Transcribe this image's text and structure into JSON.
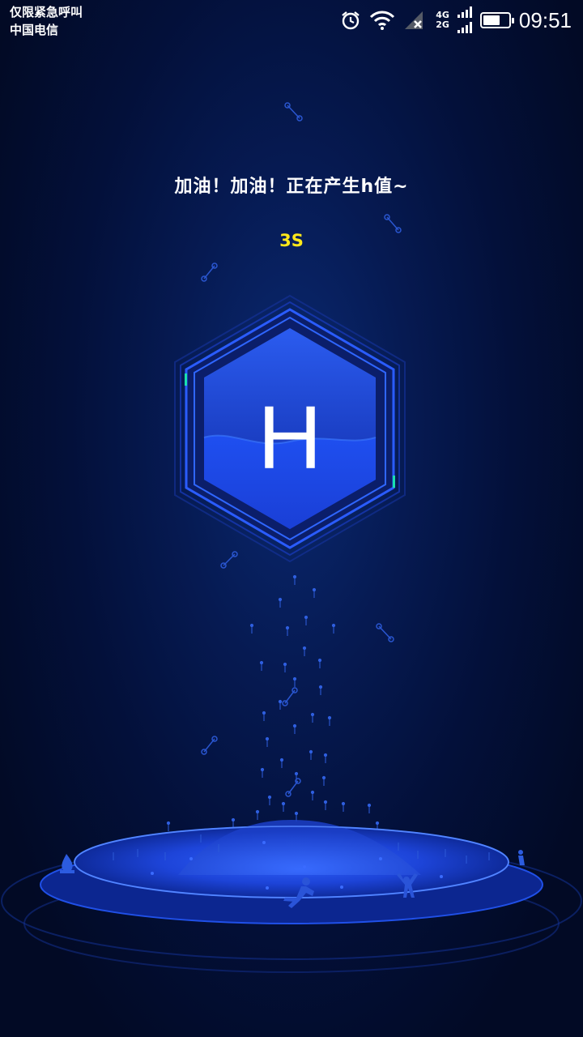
{
  "status_bar": {
    "emergency_text": "仅限紧急呼叫",
    "carrier": "中国电信",
    "network_top": "4G",
    "network_bottom": "2G",
    "time": "09:51",
    "battery_level": 0.7,
    "icons": [
      "alarm-icon",
      "wifi-icon",
      "no-signal-icon",
      "signal-icon",
      "battery-icon"
    ]
  },
  "main": {
    "message": "加油！加油！正在产生h值~",
    "countdown": "3S",
    "hex_letter": "H"
  },
  "colors": {
    "background": "#03103a",
    "accent_blue": "#1f4de0",
    "countdown_yellow": "#ffe81a",
    "teal_marker": "#19e0b0"
  }
}
